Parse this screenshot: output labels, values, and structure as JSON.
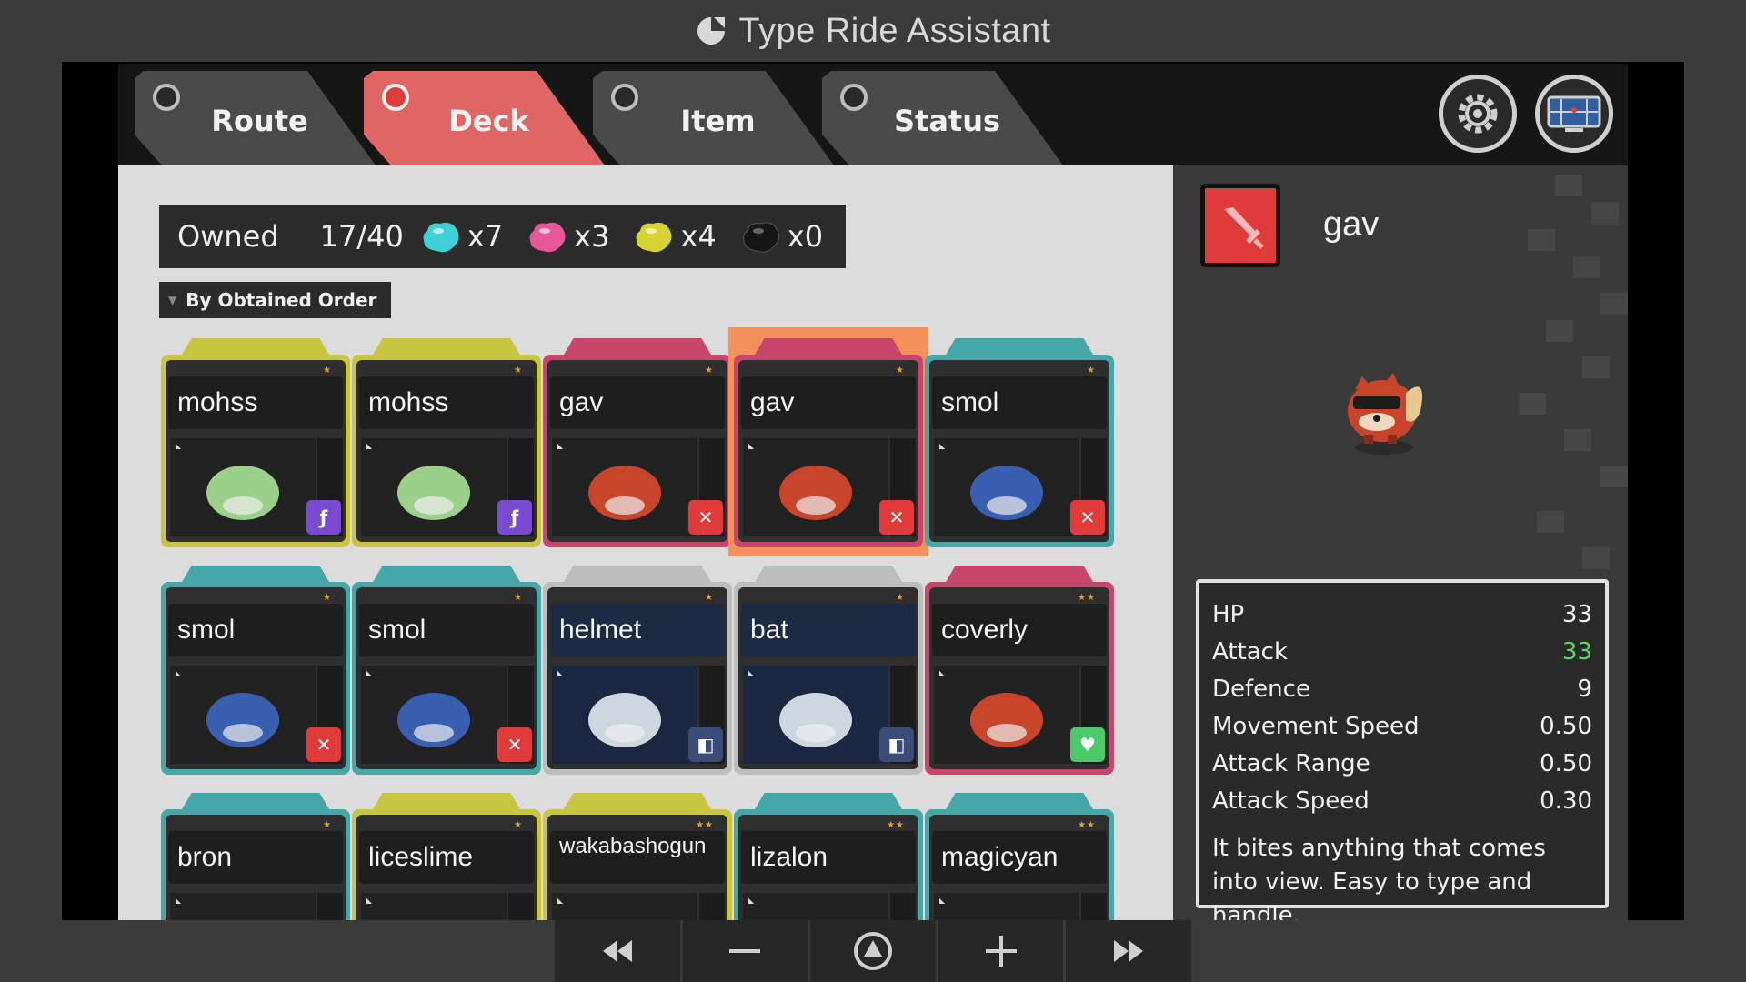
{
  "app": {
    "title": "Type Ride Assistant"
  },
  "tabs": [
    {
      "label": "Route",
      "active": false
    },
    {
      "label": "Deck",
      "active": true
    },
    {
      "label": "Item",
      "active": false
    },
    {
      "label": "Status",
      "active": false
    }
  ],
  "header_buttons": {
    "settings_icon": "gear-icon",
    "map_icon": "map-screen-icon"
  },
  "owned": {
    "label": "Owned",
    "count": "17/40",
    "gems": [
      {
        "color": "#3fd0d8",
        "amount": "x7",
        "icon": "cyan-gem-icon"
      },
      {
        "color": "#e8579a",
        "amount": "x3",
        "icon": "pink-gem-icon"
      },
      {
        "color": "#d8d235",
        "amount": "x4",
        "icon": "yellow-gem-icon"
      },
      {
        "color": "#2a2a2a",
        "amount": "x0",
        "icon": "black-gem-icon"
      }
    ]
  },
  "sort": {
    "label": "By Obtained Order"
  },
  "cards": [
    {
      "name": "mohss",
      "theme": "yellow",
      "stars": "★",
      "badge": "purple",
      "badge_glyph": "ƒ"
    },
    {
      "name": "mohss",
      "theme": "yellow",
      "stars": "★",
      "badge": "purple",
      "badge_glyph": "ƒ"
    },
    {
      "name": "gav",
      "theme": "pink",
      "stars": "★",
      "badge": "red",
      "badge_glyph": "✕"
    },
    {
      "name": "gav",
      "theme": "pink",
      "stars": "★",
      "badge": "red",
      "badge_glyph": "✕",
      "selected": true
    },
    {
      "name": "smol",
      "theme": "teal",
      "stars": "★",
      "badge": "red",
      "badge_glyph": "✕"
    },
    {
      "name": "smol",
      "theme": "teal",
      "stars": "★",
      "badge": "red",
      "badge_glyph": "✕"
    },
    {
      "name": "smol",
      "theme": "teal",
      "stars": "★",
      "badge": "red",
      "badge_glyph": "✕"
    },
    {
      "name": "helmet",
      "theme": "gray",
      "stars": "★",
      "badge": "item",
      "badge_glyph": "◧"
    },
    {
      "name": "bat",
      "theme": "gray",
      "stars": "★",
      "badge": "item",
      "badge_glyph": "◧"
    },
    {
      "name": "coverly",
      "theme": "pink",
      "stars": "★★",
      "badge": "green",
      "badge_glyph": "♥"
    },
    {
      "name": "bron",
      "theme": "teal",
      "stars": "★",
      "badge": "none",
      "badge_glyph": ""
    },
    {
      "name": "liceslime",
      "theme": "yellow",
      "stars": "★",
      "badge": "none",
      "badge_glyph": ""
    },
    {
      "name": "wakabashogun",
      "theme": "yellow",
      "stars": "★★",
      "badge": "none",
      "badge_glyph": ""
    },
    {
      "name": "lizalon",
      "theme": "teal",
      "stars": "★★",
      "badge": "none",
      "badge_glyph": ""
    },
    {
      "name": "magicyan",
      "theme": "teal",
      "stars": "★★",
      "badge": "none",
      "badge_glyph": ""
    }
  ],
  "detail": {
    "name": "gav",
    "type_icon": "sword-type-icon",
    "stats": [
      {
        "label": "HP",
        "value": "33",
        "highlight": false
      },
      {
        "label": "Attack",
        "value": "33",
        "highlight": true
      },
      {
        "label": "Defence",
        "value": "9",
        "highlight": false
      },
      {
        "label": "Movement Speed",
        "value": "0.50",
        "highlight": false
      },
      {
        "label": "Attack Range",
        "value": "0.50",
        "highlight": false
      },
      {
        "label": "Attack Speed",
        "value": "0.30",
        "highlight": false
      }
    ],
    "description": "It bites anything that comes into view. Easy to type and handle."
  },
  "controls": [
    {
      "icon": "rewind-icon",
      "glyph": "«"
    },
    {
      "icon": "minus-icon",
      "glyph": "—"
    },
    {
      "icon": "home-icon",
      "glyph": "⏶"
    },
    {
      "icon": "plus-icon",
      "glyph": "+"
    },
    {
      "icon": "fast-forward-icon",
      "glyph": "»"
    }
  ]
}
